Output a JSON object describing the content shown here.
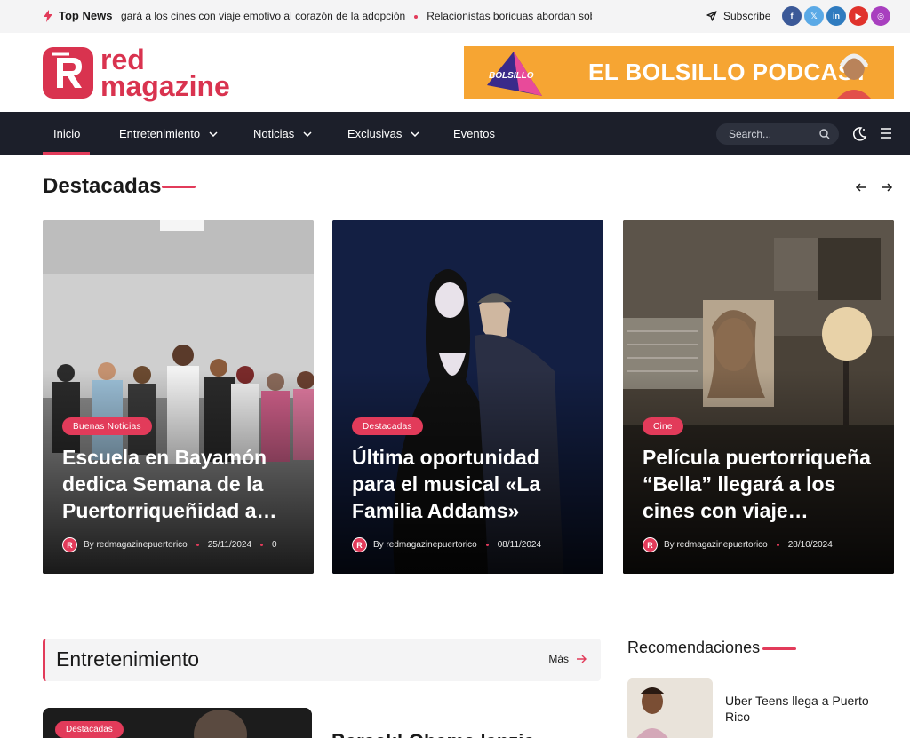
{
  "topbar": {
    "label": "Top News",
    "ticker": [
      "gará a los cines con viaje emotivo al corazón de la adopción",
      "Relacionistas boricuas abordan sobre l"
    ],
    "subscribe": "Subscribe",
    "socials": [
      {
        "icon": "facebook-icon",
        "glyph": "f",
        "color": "#3b5998"
      },
      {
        "icon": "x-icon",
        "glyph": "𝕏",
        "color": "#5aa9e6"
      },
      {
        "icon": "linkedin-icon",
        "glyph": "in",
        "color": "#2f7bbf"
      },
      {
        "icon": "youtube-icon",
        "glyph": "▶",
        "color": "#e0322c"
      },
      {
        "icon": "instagram-icon",
        "glyph": "◎",
        "color": "#a83fbf"
      }
    ]
  },
  "header": {
    "logo_line1": "red",
    "logo_line2": "magazine",
    "ad_badge": "BOLSILLO",
    "ad_title": "EL BOLSILLO PODCAST"
  },
  "nav": {
    "items": [
      "Inicio",
      "Entretenimiento",
      "Noticias",
      "Exclusivas",
      "Eventos"
    ],
    "search_placeholder": "Search..."
  },
  "featured": {
    "title": "Destacadas",
    "cards": [
      {
        "tag": "Buenas Noticias",
        "title": "Escuela en Bayamón dedica Semana de la Puertorriqueñidad a…",
        "author": "By redmagazinepuertorico",
        "date": "25/11/2024",
        "comments": "0"
      },
      {
        "tag": "Destacadas",
        "title": "Última oportunidad para el musical «La Familia Addams»",
        "author": "By redmagazinepuertorico",
        "date": "08/11/2024",
        "comments": ""
      },
      {
        "tag": "Cine",
        "title": "Película puertorriqueña “Bella” llegará a los cines con viaje emotiv…",
        "author": "By redmagazinepuertorico",
        "date": "28/10/2024",
        "comments": ""
      }
    ]
  },
  "entertainment": {
    "title": "Entretenimiento",
    "more": "Más",
    "card_tag": "Destacadas",
    "next_title": "Barack! Obama lanzia"
  },
  "recommendations": {
    "title": "Recomendaciones",
    "items": [
      {
        "title": "Uber Teens llega a Puerto Rico"
      }
    ]
  },
  "colors": {
    "accent": "#e23b5a",
    "nav": "#1c1f2a",
    "ad": "#f6a533"
  }
}
